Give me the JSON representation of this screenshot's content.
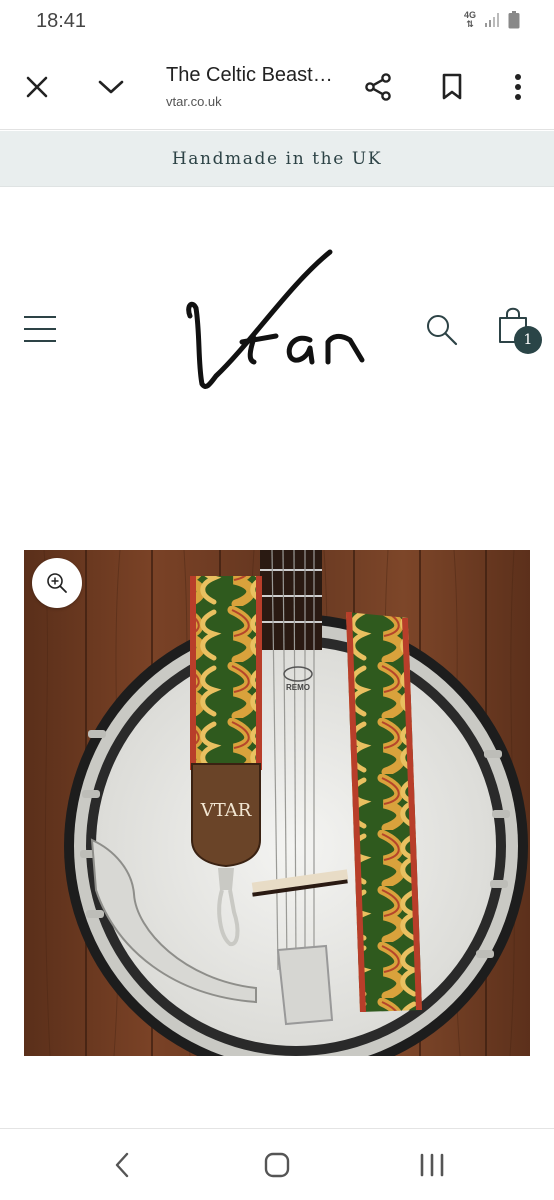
{
  "status_bar": {
    "time": "18:41",
    "network": "4G",
    "icons": [
      "data-arrows-icon",
      "signal-icon",
      "battery-icon"
    ]
  },
  "browser": {
    "page_title": "The Celtic Beast Banjo Strap",
    "url": "vtar.co.uk",
    "buttons": [
      "close-icon",
      "chevron-down-icon",
      "share-icon",
      "bookmark-icon",
      "more-vert-icon"
    ]
  },
  "announcement": {
    "text": "Handmade in the UK"
  },
  "header": {
    "logo_text": "Vtar",
    "cart_count": "1",
    "icons": [
      "menu-icon",
      "search-icon",
      "cart-icon"
    ]
  },
  "product": {
    "image_strap_label": "VTAR",
    "drumhead_brand": "REMO",
    "zoom_icon": "zoom-in-icon"
  },
  "colors": {
    "announcement_bg": "#e9eeee",
    "brand_dark": "#2a4547",
    "wood": "#6b3a22",
    "strap_green": "#2f5a1e",
    "strap_gold": "#d9a23c"
  },
  "nav_bar": {
    "icons": [
      "back-icon",
      "home-icon",
      "recents-icon"
    ]
  }
}
